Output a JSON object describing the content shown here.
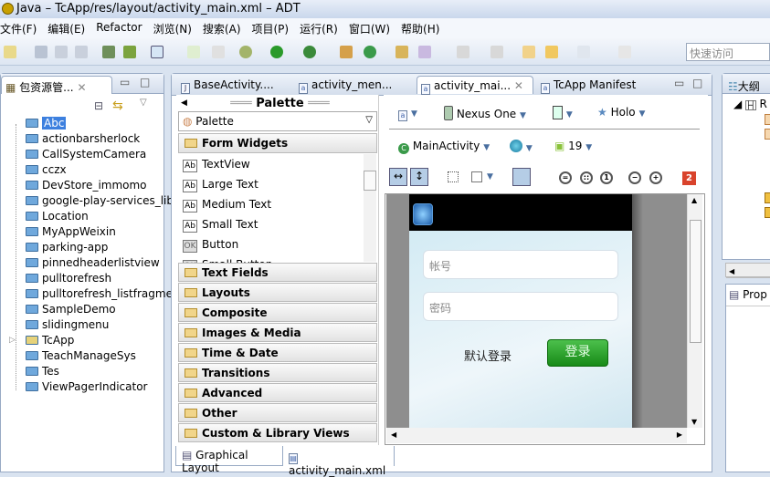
{
  "window": {
    "title": "Java – TcApp/res/layout/activity_main.xml – ADT"
  },
  "menu": [
    "文件(F)",
    "编辑(E)",
    "Refactor",
    "浏览(N)",
    "搜索(A)",
    "项目(P)",
    "运行(R)",
    "窗口(W)",
    "帮助(H)"
  ],
  "quick_access": {
    "placeholder": "快速访问"
  },
  "left_panel": {
    "title": "包资源管...",
    "projects": [
      "Abc",
      "actionbarsherlock",
      "CallSystemCamera",
      "cczx",
      "DevStore_immomo",
      "google-play-services_lib",
      "Location",
      "MyAppWeixin",
      "parking-app",
      "pinnedheaderlistview",
      "pulltorefresh",
      "pulltorefresh_listfragme",
      "SampleDemo",
      "slidingmenu",
      "TcApp",
      "TeachManageSys",
      "Tes",
      "ViewPagerIndicator"
    ],
    "selected": "Abc"
  },
  "editor_tabs": [
    "BaseActivity....",
    "activity_men...",
    "activity_mai...",
    "TcApp Manifest"
  ],
  "palette": {
    "header": "Palette",
    "dropdown": "Palette",
    "open_category": "Form Widgets",
    "items": [
      "TextView",
      "Large Text",
      "Medium Text",
      "Small Text",
      "Button",
      "Small Button"
    ],
    "item_icons": [
      "Ab",
      "Ab",
      "Ab",
      "Ab",
      "OK",
      "OK"
    ],
    "categories": [
      "Text Fields",
      "Layouts",
      "Composite",
      "Images & Media",
      "Time & Date",
      "Transitions",
      "Advanced",
      "Other",
      "Custom & Library Views"
    ]
  },
  "config": {
    "device": "Nexus One",
    "theme": "Holo",
    "activity": "MainActivity",
    "api": "19",
    "error_count": "2"
  },
  "preview": {
    "account_placeholder": "帐号",
    "password_placeholder": "密码",
    "default_login": "默认登录",
    "login_button": "登录"
  },
  "bottom_tabs": [
    "Graphical Layout",
    "activity_main.xml"
  ],
  "right_panel": {
    "outline_title": "大纲",
    "outline_root": "R",
    "properties_title": "Prop"
  }
}
